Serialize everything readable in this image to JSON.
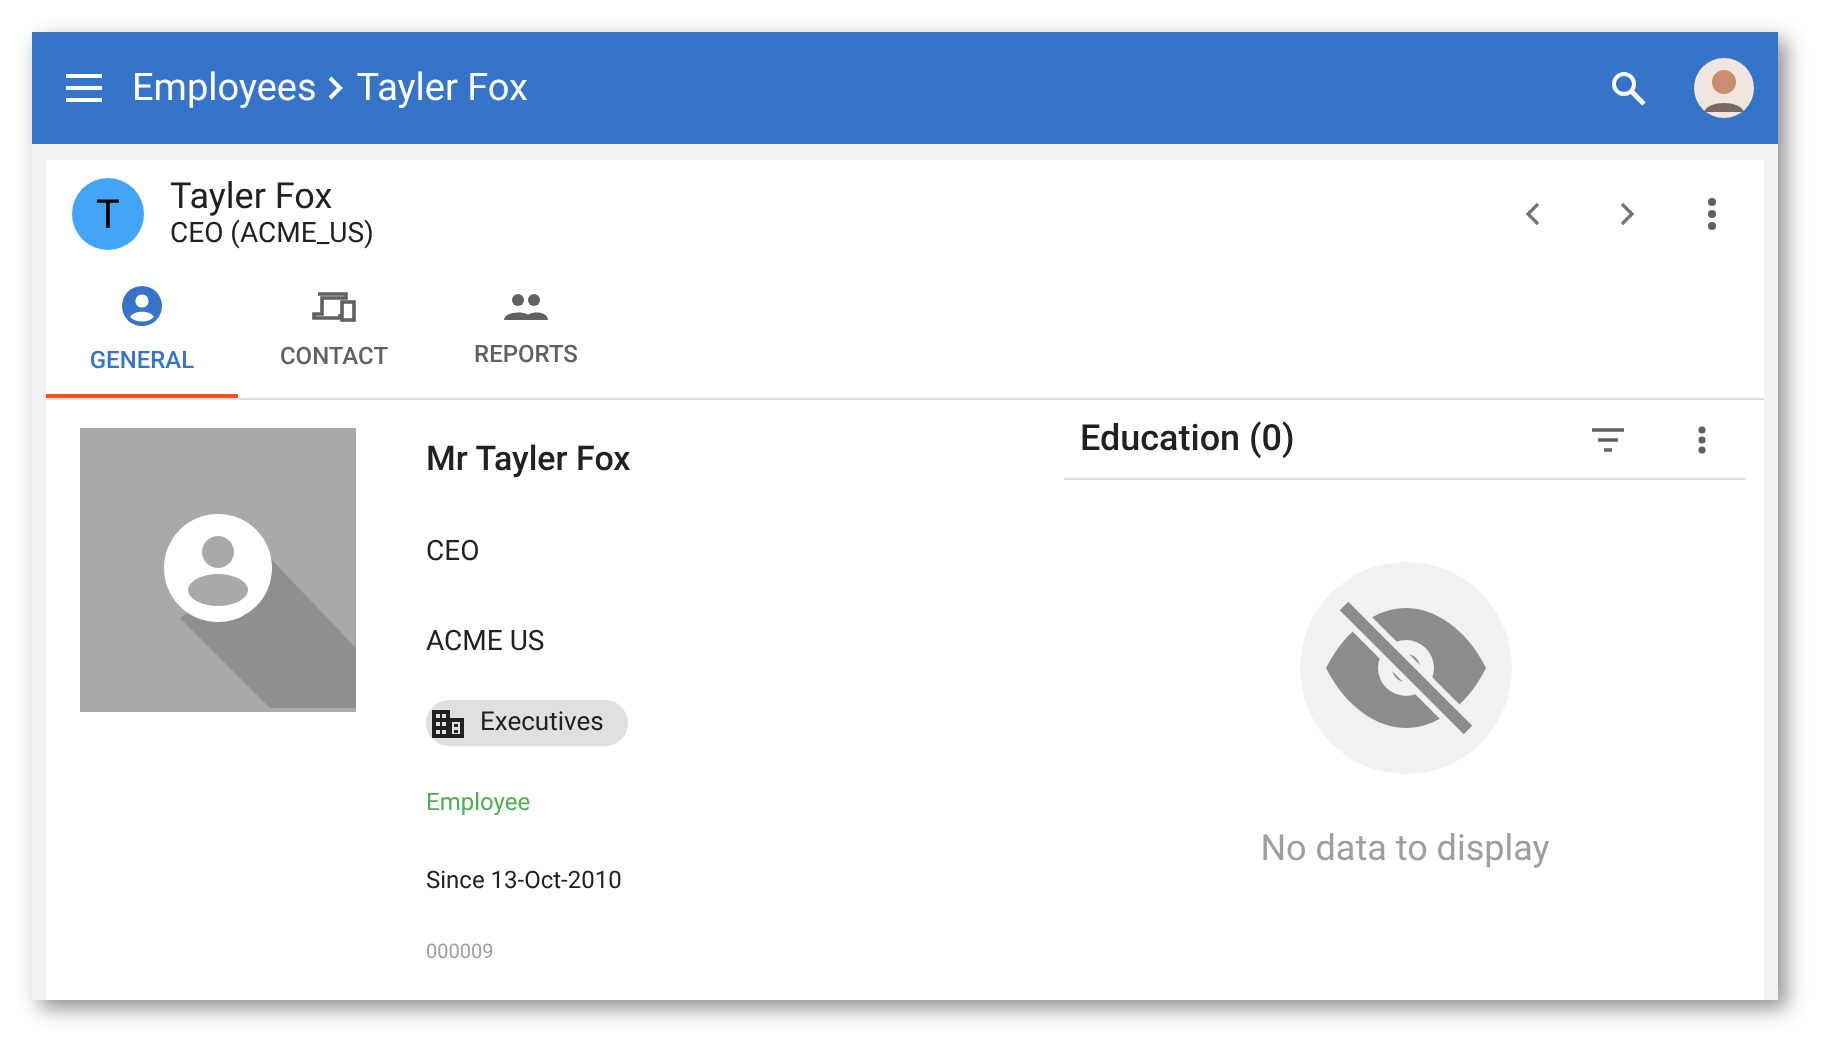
{
  "app_bar": {
    "breadcrumb": [
      "Employees",
      "Tayler Fox"
    ]
  },
  "header": {
    "initial": "T",
    "name": "Tayler Fox",
    "subtitle": "CEO (ACME_US)"
  },
  "tabs": [
    {
      "kind": "general",
      "label": "GENERAL",
      "selected": true
    },
    {
      "kind": "contact",
      "label": "CONTACT",
      "selected": false
    },
    {
      "kind": "reports",
      "label": "REPORTS",
      "selected": false
    }
  ],
  "profile": {
    "full_name": "Mr Tayler Fox",
    "title": "CEO",
    "company": "ACME US",
    "group": "Executives",
    "status": "Employee",
    "since": "Since 13-Oct-2010",
    "id": "000009"
  },
  "education": {
    "title": "Education (0)",
    "empty_message": "No data to display"
  }
}
